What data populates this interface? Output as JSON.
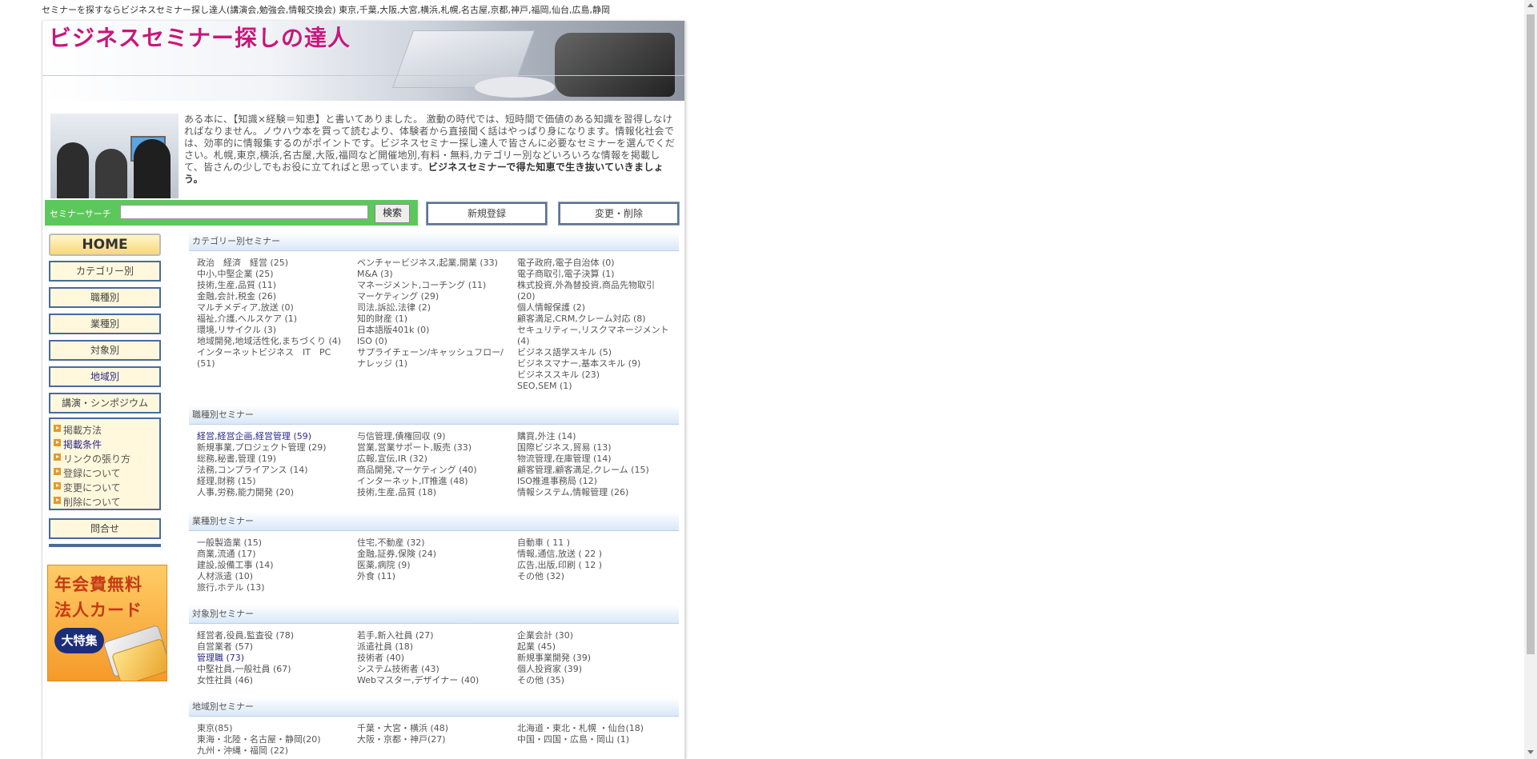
{
  "top_text": "セミナーを探すならビジネスセミナー探し達人(講演会,勉強会,情報交換会) 東京,千葉,大阪,大宮,横浜,札幌,名古屋,京都,神戸,福岡,仙台,広島,静岡",
  "site_title": "ビジネスセミナー探しの達人",
  "intro": {
    "text": "ある本に、【知識×経験＝知恵】と書いてありました。 激動の時代では、短時間で価値のある知識を習得しなければなりません。ノウハウ本を買って読むより、体験者から直接聞く話はやっぱり身になります。情報化社会では、効率的に情報集するのがポイントです。ビジネスセミナー探し達人で皆さんに必要なセミナーを選んでください。札幌,東京,横浜,名古屋,大阪,福岡など開催地別,有料・無料,カテゴリー別などいろいろな情報を掲載して、皆さんの少しでもお役に立てればと思っています。",
    "bold": "ビジネスセミナーで得た知恵で生き抜いていきましょう。"
  },
  "search": {
    "label": "セミナーサーチ",
    "value": "",
    "button": "検索"
  },
  "buttons": {
    "register": "新規登録",
    "change": "変更・削除"
  },
  "nav": {
    "home": "HOME",
    "items": [
      "カテゴリー別",
      "職種別",
      "業種別",
      "対象別",
      "地域別",
      "講演・シンポジウム"
    ],
    "sub": [
      "掲載方法",
      "掲載条件",
      "リンクの張り方",
      "登録について",
      "変更について",
      "削除について"
    ],
    "contact": "問合せ"
  },
  "promo": {
    "line1": "年会費無料",
    "line2": "法人カード",
    "badge": "大特集"
  },
  "sections": [
    {
      "title": "カテゴリー別セミナー",
      "cols": [
        [
          "政治　経済　経営 (25)",
          "中小,中堅企業 (25)",
          "技術,生産,品質 (11)",
          "金融,会計,税金 (26)",
          "マルチメディア,放送 (0)",
          "福祉,介護,ヘルスケア (1)",
          "環境,リサイクル (3)",
          "地域開発,地域活性化,まちづくり (4)",
          "インターネットビジネス　IT　PC",
          "(51)"
        ],
        [
          "ベンチャービジネス,起業,開業 (33)",
          "M&A (3)",
          "マネージメント,コーチング (11)",
          "マーケティング (29)",
          "司法,訴訟,法律 (2)",
          "知的財産 (1)",
          "日本語版401k (0)",
          "ISO (0)",
          "サプライチェーン/キャッシュフロー/",
          "ナレッジ (1)"
        ],
        [
          "電子政府,電子自治体 (0)",
          "電子商取引,電子決算 (1)",
          "株式投資,外為替投資,商品先物取引",
          "(20)",
          "個人情報保護 (2)",
          "顧客満足,CRM,クレーム対応 (8)",
          "セキュリティー,リスクマネージメント",
          "(4)",
          "ビジネス語学スキル (5)",
          "ビジネスマナー,基本スキル (9)",
          "ビジネススキル (23)",
          "SEO,SEM (1)"
        ]
      ]
    },
    {
      "title": "職種別セミナー",
      "cols": [
        [
          "経営,経営企画,経営管理 (59)",
          "新規事業,プロジェクト管理 (29)",
          "総務,秘書,管理 (19)",
          "法務,コンプライアンス (14)",
          "経理,財務 (15)",
          "人事,労務,能力開発 (20)"
        ],
        [
          "与信管理,債権回収 (9)",
          "営業,営業サポート,販売 (33)",
          "広報,宣伝,IR (32)",
          "商品開発,マーケティング (40)",
          "インターネット,IT推進 (48)",
          "技術,生産,品質 (18)"
        ],
        [
          "購買,外注 (14)",
          "国際ビジネス,貿易 (13)",
          "物流管理,在庫管理 (14)",
          "顧客管理,顧客満足,クレーム (15)",
          "ISO推進事務局 (12)",
          "情報システム,情報管理 (26)"
        ]
      ]
    },
    {
      "title": "業種別セミナー",
      "cols": [
        [
          "一般製造業 (15)",
          "商業,流通 (17)",
          "建設,設備工事 (14)",
          "人材派遣 (10)",
          "旅行,ホテル (13)"
        ],
        [
          "住宅,不動産 (32)",
          "金融,証券,保険 (24)",
          "医薬,病院 (9)",
          "外食 (11)"
        ],
        [
          "自動車 ( 11 )",
          "情報,通信,放送 ( 22 )",
          "広告,出版,印刷 ( 12 )",
          "その他 (32)"
        ]
      ]
    },
    {
      "title": "対象別セミナー",
      "cols": [
        [
          "経営者,役員,監査役 (78)",
          "自営業者 (57)",
          "管理職 (73)",
          "中堅社員,一般社員 (67)",
          "女性社員 (46)"
        ],
        [
          "若手,新入社員 (27)",
          "派遣社員 (18)",
          "技術者 (40)",
          "システム技術者 (43)",
          "Webマスター,デザイナー (40)"
        ],
        [
          "企業会計 (30)",
          "起業 (45)",
          "新規事業開発 (39)",
          "個人投資家 (39)",
          "その他 (35)"
        ]
      ]
    },
    {
      "title": "地域別セミナー",
      "cols": [
        [
          "東京(85)",
          "東海・北陸・名古屋・静岡(20)",
          "九州・沖縄・福岡 (22)"
        ],
        [
          "千葉・大宮・横浜 (48)",
          "大阪・京都・神戸(27)"
        ],
        [
          "北海道・東北・札幌 ・仙台(18)",
          "中国・四国・広島・岡山 (1)"
        ]
      ]
    }
  ]
}
